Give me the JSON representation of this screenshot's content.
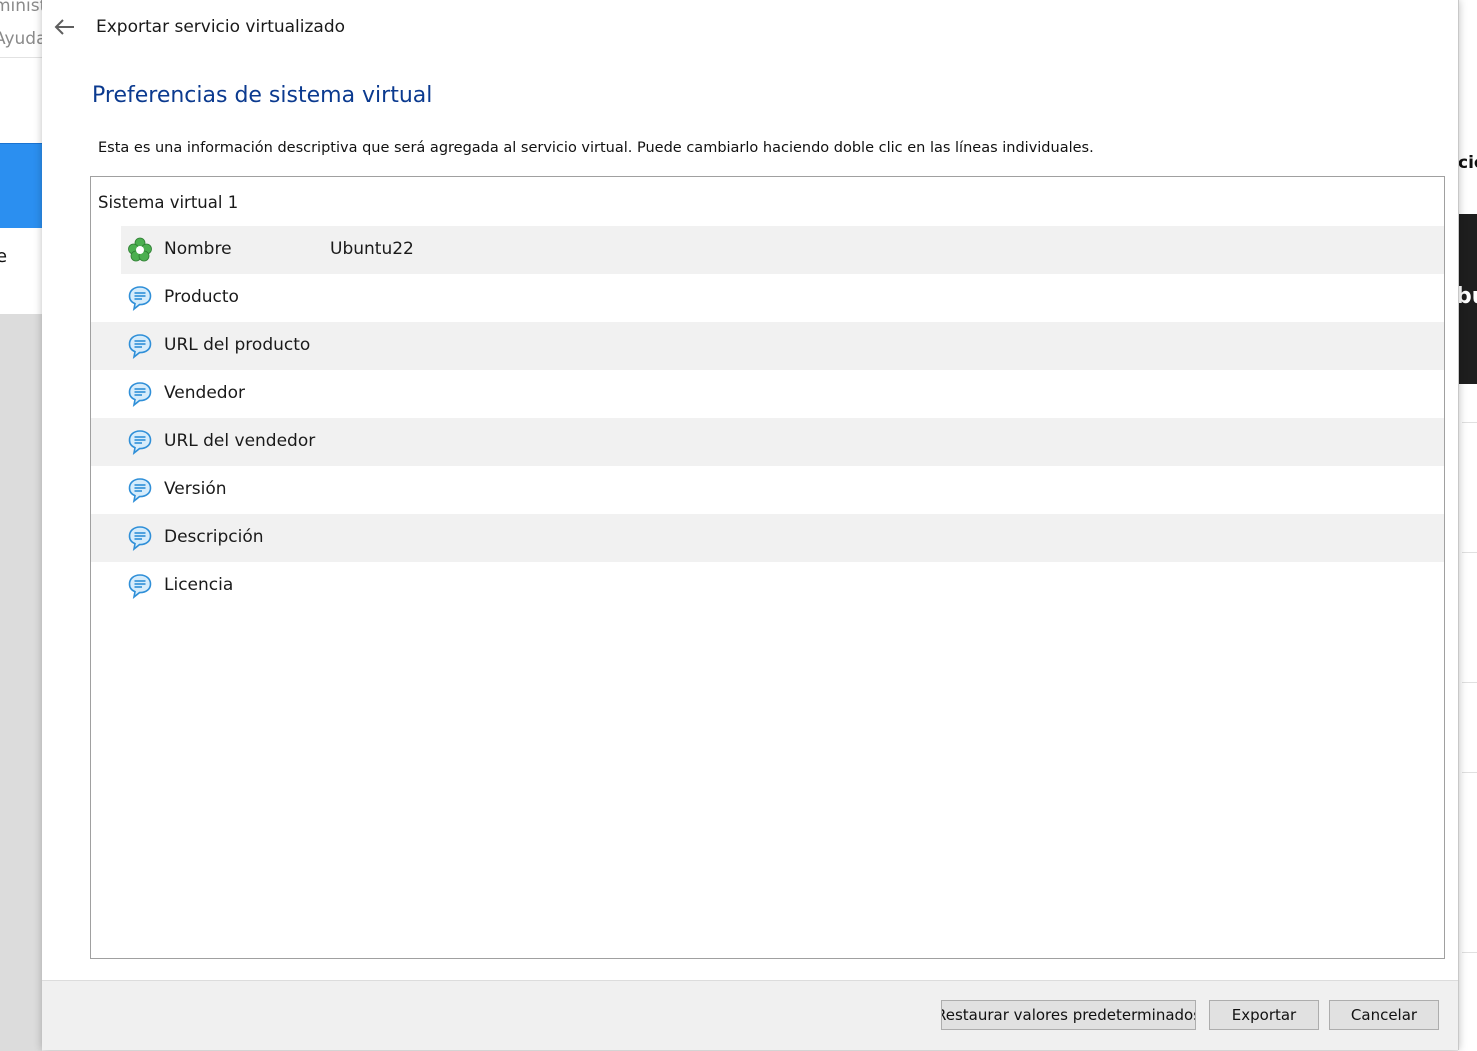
{
  "background": {
    "left_text_top": "ministr",
    "left_text_second": "Ayuda",
    "left_text_mid": "e",
    "right_text_top": "cio",
    "right_text_dark": "bu"
  },
  "dialog": {
    "title": "Exportar servicio virtualizado",
    "heading": "Preferencias de sistema virtual",
    "description": "Esta es una información descriptiva que será agregada al servicio virtual. Puede cambiarlo haciendo doble clic en las líneas individuales.",
    "tree": {
      "root_label": "Sistema virtual 1",
      "rows": [
        {
          "label": "Nombre",
          "value": "Ubuntu22",
          "icon": "name-icon"
        },
        {
          "label": "Producto",
          "value": "",
          "icon": "speech-bubble-icon"
        },
        {
          "label": "URL del producto",
          "value": "",
          "icon": "speech-bubble-icon"
        },
        {
          "label": "Vendedor",
          "value": "",
          "icon": "speech-bubble-icon"
        },
        {
          "label": "URL del vendedor",
          "value": "",
          "icon": "speech-bubble-icon"
        },
        {
          "label": "Versión",
          "value": "",
          "icon": "speech-bubble-icon"
        },
        {
          "label": "Descripción",
          "value": "",
          "icon": "speech-bubble-icon"
        },
        {
          "label": "Licencia",
          "value": "",
          "icon": "speech-bubble-icon"
        }
      ]
    },
    "buttons": {
      "restore": "Restaurar valores predeterminados",
      "export": "Exportar",
      "cancel": "Cancelar"
    }
  },
  "colors": {
    "heading": "#0b3a8f",
    "name_icon": "#4caf50",
    "bubble_icon": "#2f8fd8",
    "row_alt": "#f1f1f1"
  }
}
